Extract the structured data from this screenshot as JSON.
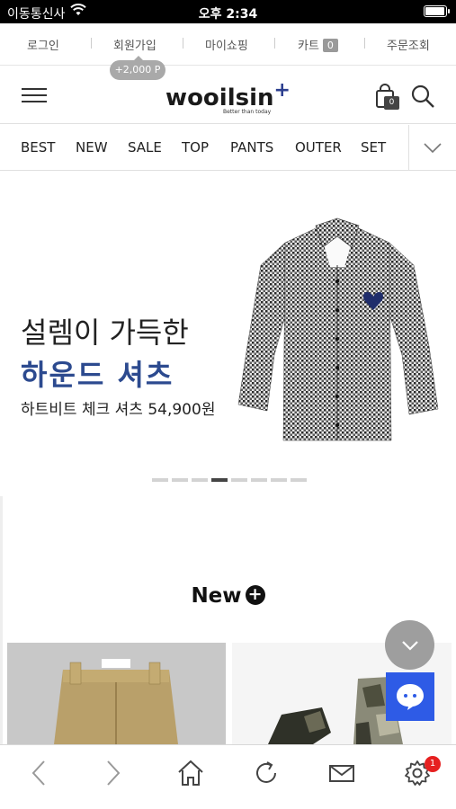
{
  "status_bar": {
    "carrier": "이동통신사",
    "time": "오후 2:34"
  },
  "top_links": {
    "login": "로그인",
    "signup": "회원가입",
    "mypage": "마이쇼핑",
    "cart": "카트",
    "cart_count": "0",
    "orders": "주문조회",
    "signup_points": "+2,000 P"
  },
  "header": {
    "logo": "wooilsin",
    "logo_plus": "+",
    "tagline": "Better than today",
    "bag_count": "0"
  },
  "categories": [
    "BEST",
    "NEW",
    "SALE",
    "TOP",
    "PANTS",
    "OUTER",
    "SET"
  ],
  "banner": {
    "line1": "설렘이 가득한",
    "line2": "하운드 셔츠",
    "line3": "하트비트 체크 셔츠 54,900원",
    "slide_count": 8,
    "active_slide": 4
  },
  "new_section": {
    "title": "New",
    "plus": "+"
  },
  "toolbar": {
    "settings_badge": "1"
  },
  "colors": {
    "accent_blue": "#2c4a8f",
    "chat_blue": "#2e5be6",
    "badge_red": "#e62020"
  }
}
